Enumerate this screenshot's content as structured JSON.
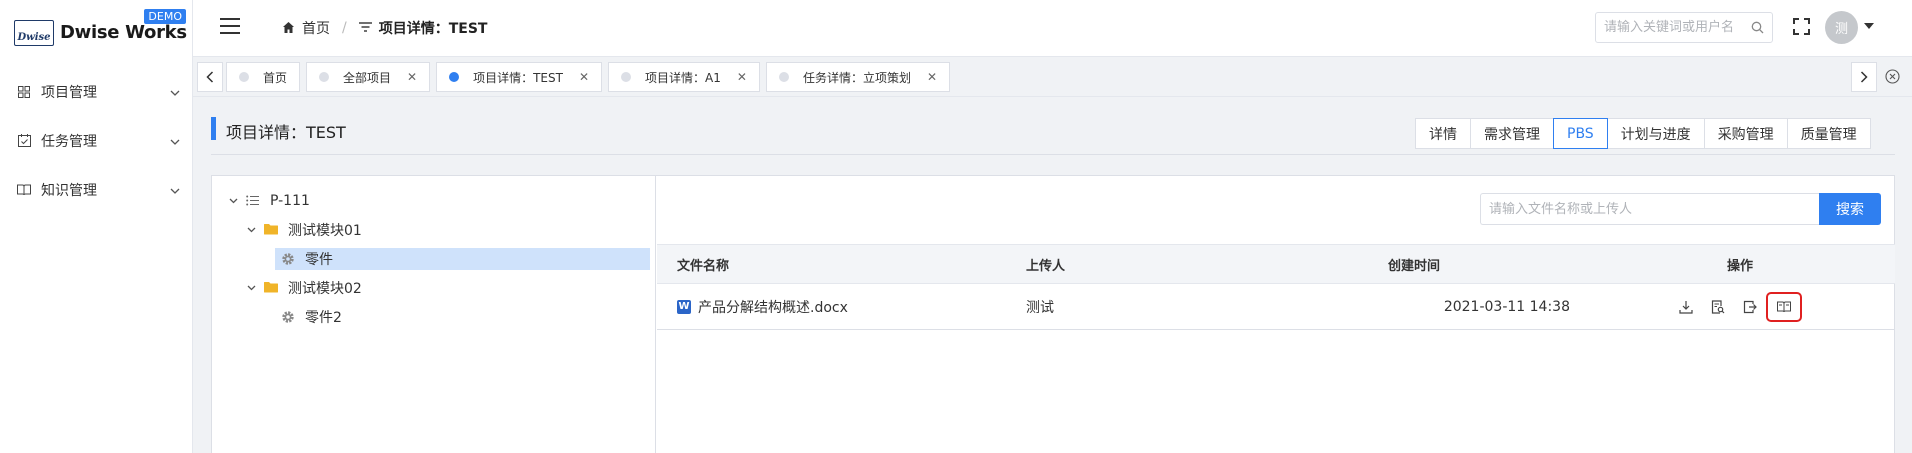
{
  "app": {
    "logo_mark": "Dwise",
    "name": "Dwise Works",
    "badge": "DEMO"
  },
  "sidebar": {
    "items": [
      {
        "label": "项目管理",
        "icon": "grid-icon"
      },
      {
        "label": "任务管理",
        "icon": "calendar-check-icon"
      },
      {
        "label": "知识管理",
        "icon": "book-icon"
      }
    ]
  },
  "header": {
    "breadcrumb": {
      "home": "首页",
      "current": "项目详情：TEST"
    },
    "search_placeholder": "请输入关键词或用户名",
    "avatar_text": "测"
  },
  "tabs": [
    {
      "label": "首页",
      "active": false,
      "closable": false
    },
    {
      "label": "全部项目",
      "active": false,
      "closable": true
    },
    {
      "label": "项目详情：TEST",
      "active": true,
      "closable": true
    },
    {
      "label": "项目详情：A1",
      "active": false,
      "closable": true
    },
    {
      "label": "任务详情：立项策划",
      "active": false,
      "closable": true
    }
  ],
  "page": {
    "title": "项目详情：TEST",
    "view_tabs": [
      "详情",
      "需求管理",
      "PBS",
      "计划与进度",
      "采购管理",
      "质量管理"
    ],
    "active_view": "PBS"
  },
  "tree": {
    "root": "P-111",
    "modules": [
      {
        "label": "测试模块01",
        "children": [
          {
            "label": "零件",
            "selected": true
          }
        ]
      },
      {
        "label": "测试模块02",
        "children": [
          {
            "label": "零件2",
            "selected": false
          }
        ]
      }
    ]
  },
  "files": {
    "search_placeholder": "请输入文件名称或上传人",
    "search_button": "搜索",
    "columns": [
      "文件名称",
      "上传人",
      "创建时间",
      "操作"
    ],
    "rows": [
      {
        "name": "产品分解结构概述.docx",
        "uploader": "测试",
        "created": "2021-03-11 14:38",
        "file_type_icon": "W"
      }
    ]
  },
  "colors": {
    "accent": "#2f7ff0",
    "selected_bg": "#cfe2fb",
    "highlight_border": "#e02020"
  }
}
